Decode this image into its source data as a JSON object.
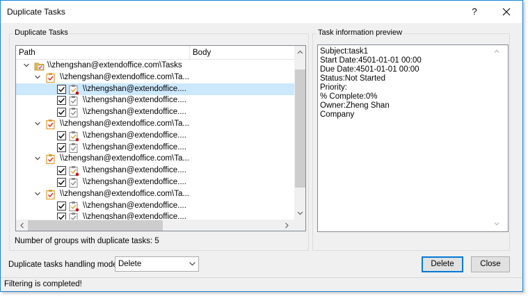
{
  "window": {
    "title": "Duplicate Tasks",
    "help": "?"
  },
  "left_group": {
    "caption": "Duplicate Tasks",
    "columns": {
      "path": "Path",
      "body": "Body"
    },
    "rows": [
      {
        "level": 0,
        "type": "folder",
        "text": "\\\\zhengshan@extendoffice.com\\Tasks",
        "selected": false
      },
      {
        "level": 1,
        "type": "group",
        "text": "\\\\zhengshan@extendoffice.com\\Ta...",
        "selected": false
      },
      {
        "level": 2,
        "type": "task-dup",
        "checked": true,
        "text": "\\\\zhengshan@extendoffice....",
        "selected": true
      },
      {
        "level": 2,
        "type": "task",
        "checked": true,
        "text": "\\\\zhengshan@extendoffice....",
        "selected": false
      },
      {
        "level": 2,
        "type": "task",
        "checked": true,
        "text": "\\\\zhengshan@extendoffice....",
        "selected": false
      },
      {
        "level": 1,
        "type": "group",
        "text": "\\\\zhengshan@extendoffice.com\\Ta...",
        "selected": false
      },
      {
        "level": 2,
        "type": "task-dup",
        "checked": true,
        "text": "\\\\zhengshan@extendoffice....",
        "selected": false
      },
      {
        "level": 2,
        "type": "task",
        "checked": true,
        "text": "\\\\zhengshan@extendoffice....",
        "selected": false
      },
      {
        "level": 1,
        "type": "group",
        "text": "\\\\zhengshan@extendoffice.com\\Ta...",
        "selected": false
      },
      {
        "level": 2,
        "type": "task-dup",
        "checked": true,
        "text": "\\\\zhengshan@extendoffice....",
        "selected": false
      },
      {
        "level": 2,
        "type": "task",
        "checked": true,
        "text": "\\\\zhengshan@extendoffice....",
        "selected": false
      },
      {
        "level": 1,
        "type": "group",
        "text": "\\\\zhengshan@extendoffice.com\\Ta...",
        "selected": false
      },
      {
        "level": 2,
        "type": "task-dup",
        "checked": true,
        "text": "\\\\zhengshan@extendoffice....",
        "selected": false
      },
      {
        "level": 2,
        "type": "task",
        "checked": true,
        "text": "\\\\zhengshan@extendoffice....",
        "selected": false
      }
    ],
    "groups_count_text": "Number of groups with duplicate tasks: 5"
  },
  "right_group": {
    "caption": "Task information preview",
    "lines": [
      "Subject:task1",
      "Start Date:4501-01-01 00:00",
      "Due Date:4501-01-01 00:00",
      "Status:Not Started",
      "Priority:",
      "% Complete:0%",
      "Owner:Zheng Shan",
      "Company"
    ]
  },
  "mode": {
    "label": "Duplicate tasks handling mode:",
    "selected": "Delete"
  },
  "buttons": {
    "delete": "Delete",
    "close": "Close"
  },
  "status": {
    "text": "Filtering is completed!"
  },
  "colors": {
    "accent": "#0078d7",
    "selection": "#cce8ff",
    "folder": "#e8b84a",
    "check_red": "#e0211a"
  }
}
